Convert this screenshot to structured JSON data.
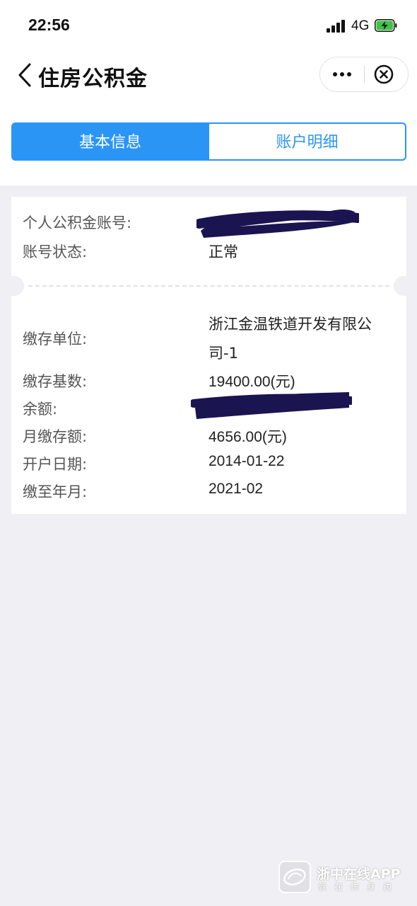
{
  "status_bar": {
    "time": "22:56",
    "network": "4G",
    "icons": [
      "signal-icon",
      "battery-charging-icon"
    ]
  },
  "nav": {
    "title": "住房公积金",
    "icons": [
      "back-icon",
      "more-icon",
      "close-icon"
    ]
  },
  "tabs": [
    {
      "label": "基本信息",
      "active": true
    },
    {
      "label": "账户明细",
      "active": false
    }
  ],
  "account": {
    "number_label": "个人公积金账号:",
    "number_value": "",
    "status_label": "账号状态:",
    "status_value": "正常"
  },
  "details": {
    "employer_label": "缴存单位:",
    "employer_value_line1": "浙江金温铁道开发有限公",
    "employer_value_line2": "司-1",
    "base_label": "缴存基数:",
    "base_value": "19400.00(元)",
    "balance_label": "余额:",
    "balance_value": "",
    "monthly_label": "月缴存额:",
    "monthly_value": "4656.00(元)",
    "open_date_label": "开户日期:",
    "open_date_value": "2014-01-22",
    "paid_until_label": "缴至年月:",
    "paid_until_value": "2021-02"
  },
  "watermark": {
    "title": "浙中在线APP",
    "subtitle": "就在你身边"
  },
  "colors": {
    "accent": "#2b95f6",
    "background": "#efeff4",
    "redaction": "#1a1450"
  }
}
